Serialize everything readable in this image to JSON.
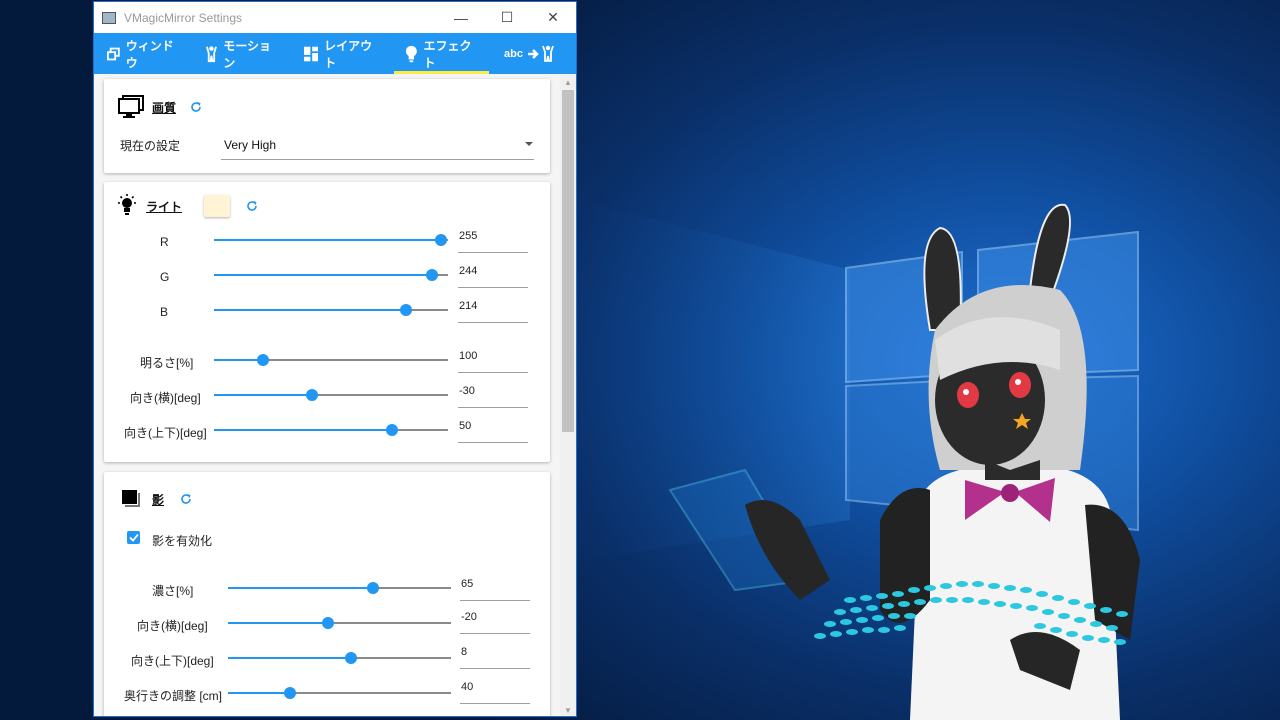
{
  "window": {
    "title": "VMagicMirror Settings",
    "controls": {
      "minimize": "—",
      "maximize": "☐",
      "close": "✕"
    }
  },
  "tabs": [
    {
      "label": "ウィンドウ",
      "icon": "window-icon",
      "active": false
    },
    {
      "label": "モーション",
      "icon": "person-icon",
      "active": false
    },
    {
      "label": "レイアウト",
      "icon": "layout-icon",
      "active": false
    },
    {
      "label": "エフェクト",
      "icon": "lightbulb-icon",
      "active": true
    },
    {
      "label": "abc",
      "icon": "text-to-motion-icon",
      "active": false
    }
  ],
  "quality": {
    "title": "画質",
    "setting_label": "現在の設定",
    "setting_value": "Very High"
  },
  "light": {
    "title": "ライト",
    "color": "#fff4d6",
    "sliders": [
      {
        "label": "R",
        "value": "255",
        "fraction": 0.97
      },
      {
        "label": "G",
        "value": "244",
        "fraction": 0.93
      },
      {
        "label": "B",
        "value": "214",
        "fraction": 0.82
      },
      {
        "label": "明るさ[%]",
        "value": "100",
        "fraction": 0.21
      },
      {
        "label": "向き(横)[deg]",
        "value": "-30",
        "fraction": 0.42
      },
      {
        "label": "向き(上下)[deg]",
        "value": "50",
        "fraction": 0.76
      }
    ]
  },
  "shadow": {
    "title": "影",
    "enable_label": "影を有効化",
    "enabled": true,
    "sliders": [
      {
        "label": "濃さ[%]",
        "value": "65",
        "fraction": 0.65
      },
      {
        "label": "向き(横)[deg]",
        "value": "-20",
        "fraction": 0.45
      },
      {
        "label": "向き(上下)[deg]",
        "value": "8",
        "fraction": 0.55
      },
      {
        "label": "奥行きの調整 [cm]",
        "value": "40",
        "fraction": 0.28
      }
    ]
  },
  "colors": {
    "accent": "#2196f3",
    "tab_indicator": "#ffeb3b"
  }
}
